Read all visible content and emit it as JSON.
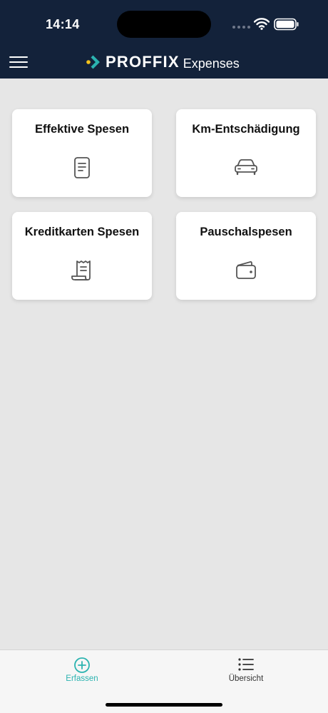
{
  "status_bar": {
    "time": "14:14"
  },
  "header": {
    "brand": "PROFFIX",
    "app_name": "Expenses"
  },
  "tiles": [
    {
      "label": "Effektive Spesen",
      "icon": "document-icon"
    },
    {
      "label": "Km-Entschädigung",
      "icon": "car-icon"
    },
    {
      "label": "Kreditkarten Spesen",
      "icon": "receipt-icon"
    },
    {
      "label": "Pauschalspesen",
      "icon": "wallet-icon"
    }
  ],
  "tabbar": {
    "tabs": [
      {
        "label": "Erfassen",
        "icon": "plus-circle-icon",
        "active": true
      },
      {
        "label": "Übersicht",
        "icon": "list-icon",
        "active": false
      }
    ]
  },
  "colors": {
    "header_bg": "#13223a",
    "page_bg": "#e6e6e6",
    "accent": "#2bb3b0",
    "logo_yellow": "#f4c21b",
    "logo_teal": "#2bb3b0"
  }
}
